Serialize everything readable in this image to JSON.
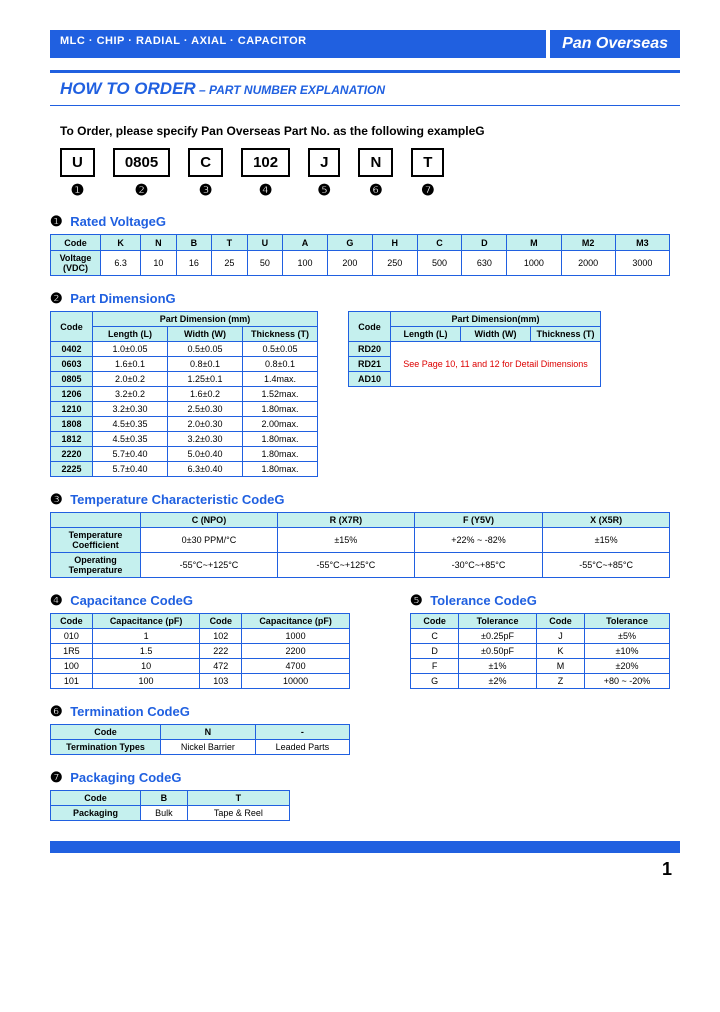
{
  "header": {
    "left": "MLC · CHIP · RADIAL · AXIAL · CAPACITOR",
    "right": "Pan Overseas"
  },
  "title": {
    "main": "HOW TO ORDER",
    "sub": " – PART NUMBER EXPLANATION"
  },
  "orderLine": "To Order, please specify Pan Overseas Part No. as the following exampleG",
  "parts": [
    "U",
    "0805",
    "C",
    "102",
    "J",
    "N",
    "T"
  ],
  "nums": [
    "❶",
    "❷",
    "❸",
    "❹",
    "❺",
    "❻",
    "❼"
  ],
  "s1": {
    "title": "Rated VoltageG",
    "h": [
      "Code",
      "K",
      "N",
      "B",
      "T",
      "U",
      "A",
      "G",
      "H",
      "C",
      "D",
      "M",
      "M2",
      "M3"
    ],
    "r": [
      "Voltage (VDC)",
      "6.3",
      "10",
      "16",
      "25",
      "50",
      "100",
      "200",
      "250",
      "500",
      "630",
      "1000",
      "2000",
      "3000"
    ]
  },
  "s2": {
    "title": "Part DimensionG",
    "a": {
      "head": [
        "Code",
        "Part Dimension (mm)"
      ],
      "sub": [
        "Length (L)",
        "Width (W)",
        "Thickness (T)"
      ],
      "rows": [
        [
          "0402",
          "1.0±0.05",
          "0.5±0.05",
          "0.5±0.05"
        ],
        [
          "0603",
          "1.6±0.1",
          "0.8±0.1",
          "0.8±0.1"
        ],
        [
          "0805",
          "2.0±0.2",
          "1.25±0.1",
          "1.4max."
        ],
        [
          "1206",
          "3.2±0.2",
          "1.6±0.2",
          "1.52max."
        ],
        [
          "1210",
          "3.2±0.30",
          "2.5±0.30",
          "1.80max."
        ],
        [
          "1808",
          "4.5±0.35",
          "2.0±0.30",
          "2.00max."
        ],
        [
          "1812",
          "4.5±0.35",
          "3.2±0.30",
          "1.80max."
        ],
        [
          "2220",
          "5.7±0.40",
          "5.0±0.40",
          "1.80max."
        ],
        [
          "2225",
          "5.7±0.40",
          "6.3±0.40",
          "1.80max."
        ]
      ]
    },
    "b": {
      "head": [
        "Code",
        "Part Dimension(mm)"
      ],
      "sub": [
        "Length (L)",
        "Width (W)",
        "Thickness (T)"
      ],
      "codes": [
        "RD20",
        "RD21",
        "AD10"
      ],
      "note": "See Page 10, 11 and 12 for Detail Dimensions"
    }
  },
  "s3": {
    "title": "Temperature Characteristic CodeG",
    "h": [
      "",
      "C (NPO)",
      "R (X7R)",
      "F (Y5V)",
      "X (X5R)"
    ],
    "r1": [
      "Temperature Coefficient",
      "0±30 PPM/°C",
      "±15%",
      "+22% ~ -82%",
      "±15%"
    ],
    "r2": [
      "Operating Temperature",
      "-55°C~+125°C",
      "-55°C~+125°C",
      "-30°C~+85°C",
      "-55°C~+85°C"
    ]
  },
  "s4": {
    "title": "Capacitance CodeG",
    "h": [
      "Code",
      "Capacitance (pF)",
      "Code",
      "Capacitance (pF)"
    ],
    "rows": [
      [
        "010",
        "1",
        "102",
        "1000"
      ],
      [
        "1R5",
        "1.5",
        "222",
        "2200"
      ],
      [
        "100",
        "10",
        "472",
        "4700"
      ],
      [
        "101",
        "100",
        "103",
        "10000"
      ]
    ]
  },
  "s5": {
    "title": "Tolerance CodeG",
    "h": [
      "Code",
      "Tolerance",
      "Code",
      "Tolerance"
    ],
    "rows": [
      [
        "C",
        "±0.25pF",
        "J",
        "±5%"
      ],
      [
        "D",
        "±0.50pF",
        "K",
        "±10%"
      ],
      [
        "F",
        "±1%",
        "M",
        "±20%"
      ],
      [
        "G",
        "±2%",
        "Z",
        "+80 ~ -20%"
      ]
    ]
  },
  "s6": {
    "title": "Termination CodeG",
    "h": [
      "Code",
      "N",
      "-"
    ],
    "r": [
      "Termination Types",
      "Nickel Barrier",
      "Leaded Parts"
    ]
  },
  "s7": {
    "title": "Packaging CodeG",
    "h": [
      "Code",
      "B",
      "T"
    ],
    "r": [
      "Packaging",
      "Bulk",
      "Tape & Reel"
    ]
  },
  "pageNum": "1"
}
